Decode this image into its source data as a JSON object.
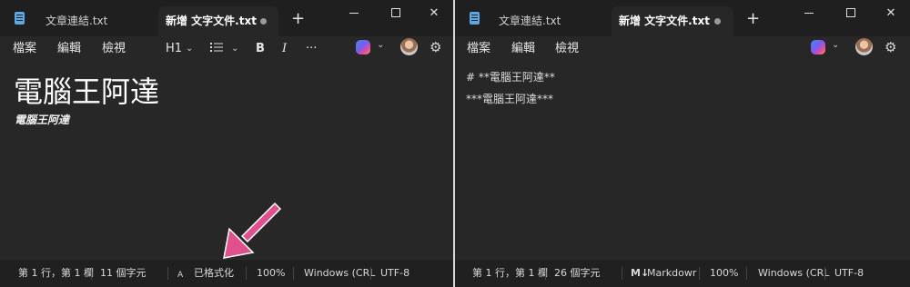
{
  "left": {
    "tabs": [
      {
        "label": "文章連結.txt",
        "active": false
      },
      {
        "label": "新增 文字文件.txt",
        "active": true
      }
    ],
    "menu": [
      "檔案",
      "編輯",
      "檢視"
    ],
    "toolbar": {
      "heading": "H1",
      "bold": "B",
      "italic": "I",
      "more": "···"
    },
    "content": {
      "heading": "電腦王阿達",
      "bold_italic": "電腦王阿達"
    },
    "status": {
      "position": "第 1 行，第 1 欄",
      "chars": "11 個字元",
      "format_icon": "A",
      "format_mode": "已格式化",
      "zoom": "100%",
      "line_ending": "Windows (CRL",
      "encoding": "UTF-8"
    }
  },
  "right": {
    "tabs": [
      {
        "label": "文章連結.txt",
        "active": false
      },
      {
        "label": "新增 文字文件.txt",
        "active": true
      }
    ],
    "menu": [
      "檔案",
      "編輯",
      "檢視"
    ],
    "content": {
      "line1": "# **電腦王阿達**",
      "line2": "***電腦王阿達***"
    },
    "status": {
      "position": "第 1 行，第 1 欄",
      "chars": "26 個字元",
      "format_icon": "M↓",
      "format_mode": "Markdowr",
      "zoom": "100%",
      "line_ending": "Windows (CRL",
      "encoding": "UTF-8"
    }
  },
  "window_controls": {
    "minimize": "—",
    "maximize": "☐",
    "close": "✕"
  },
  "colors": {
    "accent_arrow": "#e0508a",
    "background": "#272727",
    "titlebar": "#1f1f1f"
  }
}
